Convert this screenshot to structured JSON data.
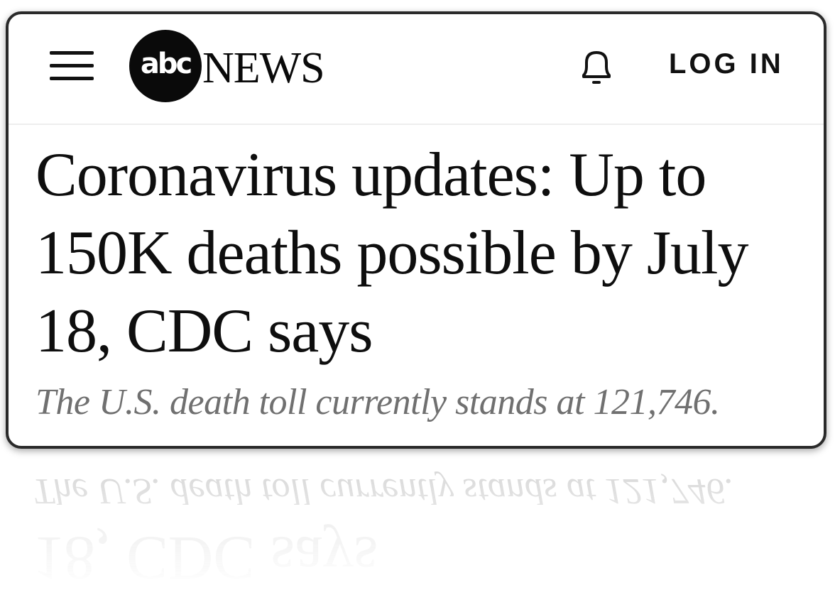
{
  "header": {
    "menu_icon": "hamburger-menu-icon",
    "logo": {
      "abc": "abc",
      "news": "NEWS"
    },
    "notification_icon": "bell-icon",
    "login_label": "LOG IN"
  },
  "article": {
    "headline": "Coronavirus updates: Up to 150K deaths possible by July 18, CDC says",
    "subheadline": "The U.S. death toll currently stands at 121,746."
  },
  "colors": {
    "text": "#0e0e0e",
    "subhead": "#707070",
    "border": "#2a2a2a",
    "logo_circle": "#0a0a0a"
  }
}
